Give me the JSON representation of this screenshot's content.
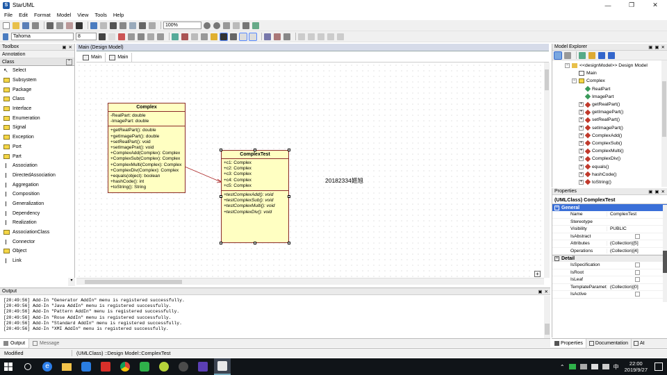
{
  "window": {
    "title": "StarUML",
    "controls": [
      "—",
      "❐",
      "✕"
    ]
  },
  "menu": [
    "File",
    "Edit",
    "Format",
    "Model",
    "View",
    "Tools",
    "Help"
  ],
  "toolbar": {
    "zoom": "100%",
    "font": "Tahoma",
    "font_size": "8"
  },
  "toolbox": {
    "title": "Toolbox",
    "section1": "Annotation",
    "section2": "Class",
    "items": [
      "Select",
      "Subsystem",
      "Package",
      "Class",
      "Interface",
      "Enumeration",
      "Signal",
      "Exception",
      "Port",
      "Part",
      "Association",
      "DirectedAssociation",
      "Aggregation",
      "Composition",
      "Generalization",
      "Dependency",
      "Realization",
      "AssociationClass",
      "Connector",
      "Object",
      "Link"
    ]
  },
  "diagram": {
    "tab_title": "Main (Design Model)",
    "tabs": [
      "Main",
      "Main"
    ],
    "label_text": "20182334姬旭",
    "complex": {
      "name": "Complex",
      "attributes": [
        "-RealPart: double",
        "-ImagePart: double"
      ],
      "operations": [
        "+getRealPart(): double",
        "+getImagePart(): double",
        "+setRealPart(): void",
        "+setImagePrat(): void",
        "+ComplexAdd(Complex): Complex",
        "+ComplexSub(Complex): Complex",
        "+ComplexMulti(Complex): Complex",
        "+ComplexDiv(Complex): Complex",
        "+equals(object): boolean",
        "+hashCode(): int",
        "+toString(): String"
      ]
    },
    "complextest": {
      "name": "ComplexTest",
      "attributes": [
        "+c1: Complex",
        "+c2: Complex",
        "+c3: Complex",
        "+c4: Complex",
        "+c5: Complex"
      ],
      "operations": [
        "+testComplexAdd(): void",
        "+testComplexSub(): void",
        "+testComplexMulti(): void",
        "+testComplexDiv(): void"
      ]
    }
  },
  "explorer": {
    "title": "Model Explorer",
    "items": [
      {
        "label": "<<designModel>> Design Model",
        "indent": 1
      },
      {
        "label": "Main",
        "indent": 2
      },
      {
        "label": "Complex",
        "indent": 2
      },
      {
        "label": "RealPart",
        "indent": 3
      },
      {
        "label": "ImagePart",
        "indent": 3
      },
      {
        "label": "getRealPart()",
        "indent": 3
      },
      {
        "label": "getImagePart()",
        "indent": 3
      },
      {
        "label": "setRealPart()",
        "indent": 3
      },
      {
        "label": "setImagePart()",
        "indent": 3
      },
      {
        "label": "ComplexAdd()",
        "indent": 3
      },
      {
        "label": "ComplexSub()",
        "indent": 3
      },
      {
        "label": "ComplexMulti()",
        "indent": 3
      },
      {
        "label": "ComplexDiv()",
        "indent": 3
      },
      {
        "label": "equals()",
        "indent": 3
      },
      {
        "label": "hashCode()",
        "indent": 3
      },
      {
        "label": "toString()",
        "indent": 3
      }
    ]
  },
  "properties": {
    "title": "Properties",
    "header": "(UMLClass) ComplexTest",
    "general_label": "General",
    "general": [
      {
        "k": "Name",
        "v": "ComplexTest"
      },
      {
        "k": "Stereotype",
        "v": ""
      },
      {
        "k": "Visibility",
        "v": "PUBLIC"
      },
      {
        "k": "IsAbstract",
        "v": ""
      },
      {
        "k": "Attributes",
        "v": "(Collection)[5]"
      },
      {
        "k": "Operations",
        "v": "(Collection)[4]"
      }
    ],
    "detail_label": "Detail",
    "detail": [
      {
        "k": "IsSpecification",
        "v": ""
      },
      {
        "k": "IsRoot",
        "v": ""
      },
      {
        "k": "IsLeaf",
        "v": ""
      },
      {
        "k": "TemplateParamet",
        "v": "(Collection)[0]"
      },
      {
        "k": "IsActive",
        "v": ""
      }
    ],
    "bottom_tabs": [
      "Properties",
      "Documentation",
      "At"
    ]
  },
  "output": {
    "title": "Output",
    "lines": [
      "[20:49:56]  Add-In \"Generator AddIn\" menu is registered successfully.",
      "[20:49:56]  Add-In \"Java AddIn\" menu is registered successfully.",
      "[20:49:56]  Add-In \"Pattern AddIn\" menu is registered successfully.",
      "[20:49:56]  Add-In \"Rose AddIn\" menu is registered successfully.",
      "[20:49:56]  Add-In \"Standard AddIn\" menu is registered successfully.",
      "[20:49:56]  Add-In \"XMI AddIn\" menu is registered successfully."
    ],
    "tabs": [
      "Output",
      "Message"
    ]
  },
  "status": {
    "mode": "Modified",
    "path": "(UMLClass) ::Design Model::ComplexTest"
  },
  "taskbar": {
    "time": "22:00",
    "date": "2019/9/27",
    "lang": "中"
  }
}
